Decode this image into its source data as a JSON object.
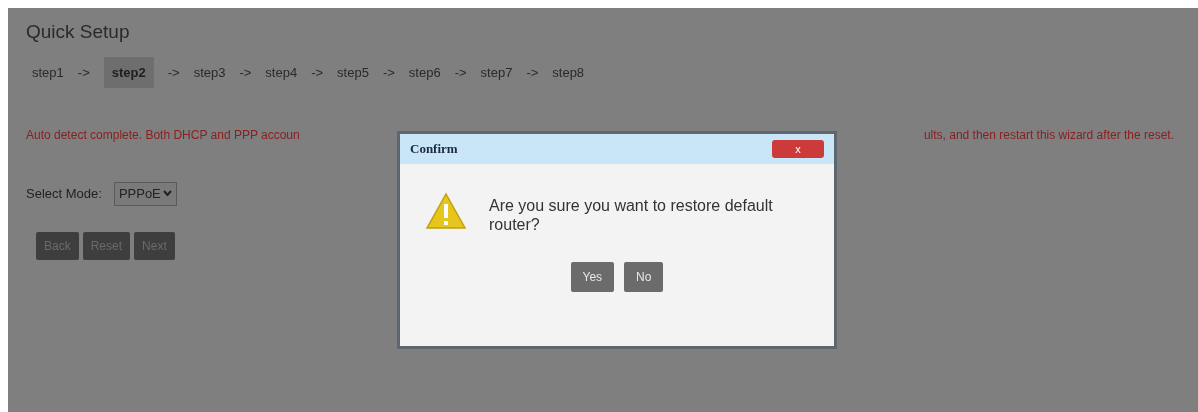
{
  "page": {
    "title": "Quick Setup",
    "trail": [
      {
        "kind": "step",
        "label": "step1",
        "selected": false
      },
      {
        "kind": "arrow",
        "label": "->"
      },
      {
        "kind": "step",
        "label": "step2",
        "selected": true
      },
      {
        "kind": "arrow",
        "label": "->"
      },
      {
        "kind": "step",
        "label": "step3",
        "selected": false
      },
      {
        "kind": "arrow",
        "label": "->"
      },
      {
        "kind": "step",
        "label": "step4",
        "selected": false
      },
      {
        "kind": "arrow",
        "label": "->"
      },
      {
        "kind": "step",
        "label": "step5",
        "selected": false
      },
      {
        "kind": "arrow",
        "label": "->"
      },
      {
        "kind": "step",
        "label": "step6",
        "selected": false
      },
      {
        "kind": "arrow",
        "label": "->"
      },
      {
        "kind": "step",
        "label": "step7",
        "selected": false
      },
      {
        "kind": "arrow",
        "label": "->"
      },
      {
        "kind": "step",
        "label": "step8",
        "selected": false
      }
    ],
    "message_left": "Auto detect complete. Both DHCP and PPP accoun",
    "message_right": "ults, and then restart this wizard after the reset.",
    "mode_label": "Select Mode:",
    "mode_value": "PPPoE",
    "buttons": [
      "Back",
      "Reset",
      "Next"
    ]
  },
  "dialog": {
    "title": "Confirm",
    "close": "x",
    "message": "Are you sure you want to restore default router?",
    "buttons": [
      "Yes",
      "No"
    ]
  }
}
